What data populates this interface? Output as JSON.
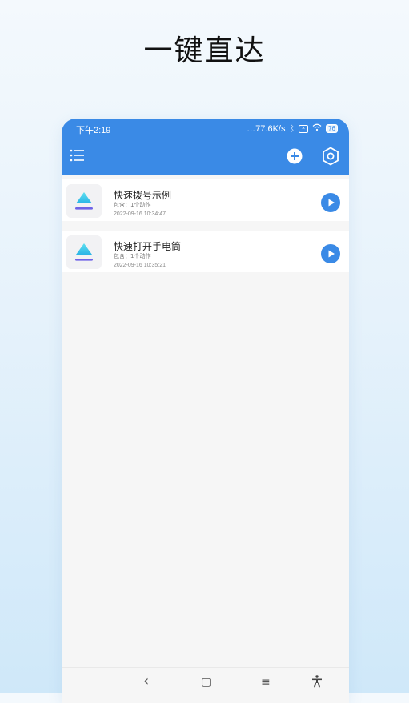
{
  "headline": "一键直达",
  "status_bar": {
    "time": "下午2:19",
    "speed": "77.6K/s",
    "battery": "76"
  },
  "toolbar": {
    "menu_icon": "list-menu-icon",
    "add_icon": "add-circle-icon",
    "settings_icon": "hexagon-settings-icon",
    "accent": "#3a8ae6"
  },
  "shortcuts": [
    {
      "title": "快速拨号示例",
      "subtitle": "包含：1个动作",
      "date": "2022-09-16 10:34:47"
    },
    {
      "title": "快速打开手电筒",
      "subtitle": "包含：1个动作",
      "date": "2022-09-16 10:35:21"
    }
  ],
  "nav": {
    "back": "‹",
    "home": "▢",
    "recents": "≡",
    "accessibility": "accessibility-icon"
  }
}
